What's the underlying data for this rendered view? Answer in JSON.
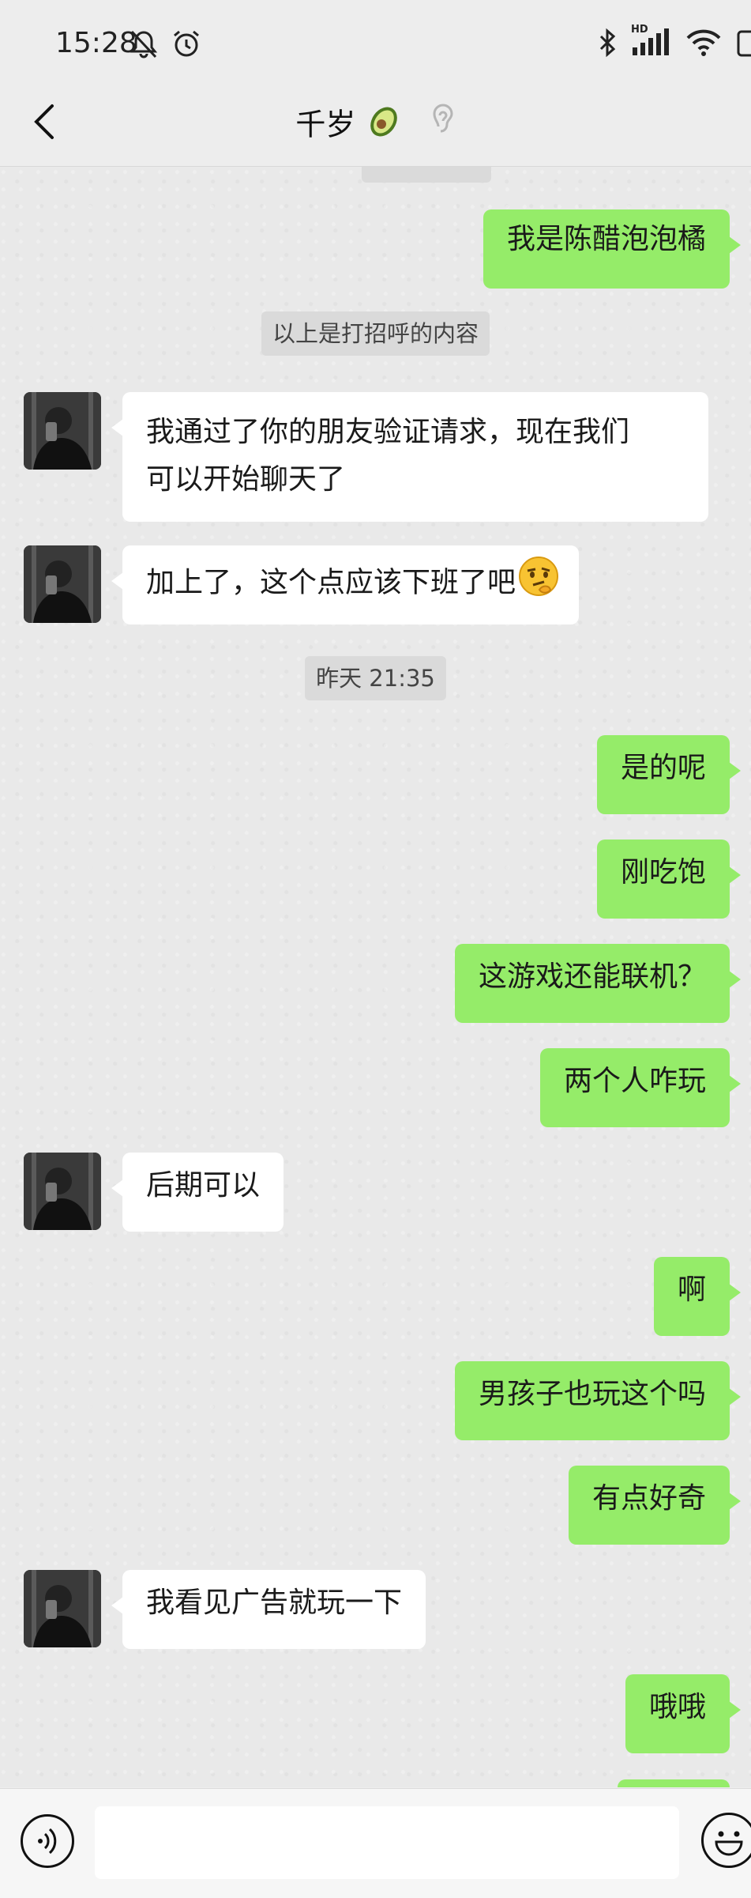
{
  "status": {
    "time": "15:28",
    "network_label": "HD"
  },
  "header": {
    "title": "千岁"
  },
  "messages": {
    "m1": "我是陈醋泡泡橘",
    "sys1": "以上是打招呼的内容",
    "m2_line1": "我通过了你的朋友验证请求，现在我们",
    "m2_line2": "可以开始聊天了",
    "m3": "加上了，这个点应该下班了吧",
    "time1": "昨天 21:35",
    "m4": "是的呢",
    "m5": "刚吃饱",
    "m6": "这游戏还能联机？",
    "m7": "两个人咋玩",
    "m8": "后期可以",
    "m9": "啊",
    "m10": "男孩子也玩这个吗",
    "m11": "有点好奇",
    "m12": "我看见广告就玩一下",
    "m13": "哦哦"
  },
  "input": {
    "placeholder": ""
  },
  "colors": {
    "sent_bubble": "#95ec69",
    "received_bubble": "#ffffff",
    "background": "#ededed"
  },
  "icons": [
    "mute-bell-icon",
    "alarm-icon",
    "bluetooth-icon",
    "signal-icon",
    "wifi-icon",
    "battery-icon",
    "back-chevron-icon",
    "avocado-emoji",
    "ear-icon",
    "thinking-face-emoji",
    "voice-icon",
    "emoji-icon"
  ]
}
